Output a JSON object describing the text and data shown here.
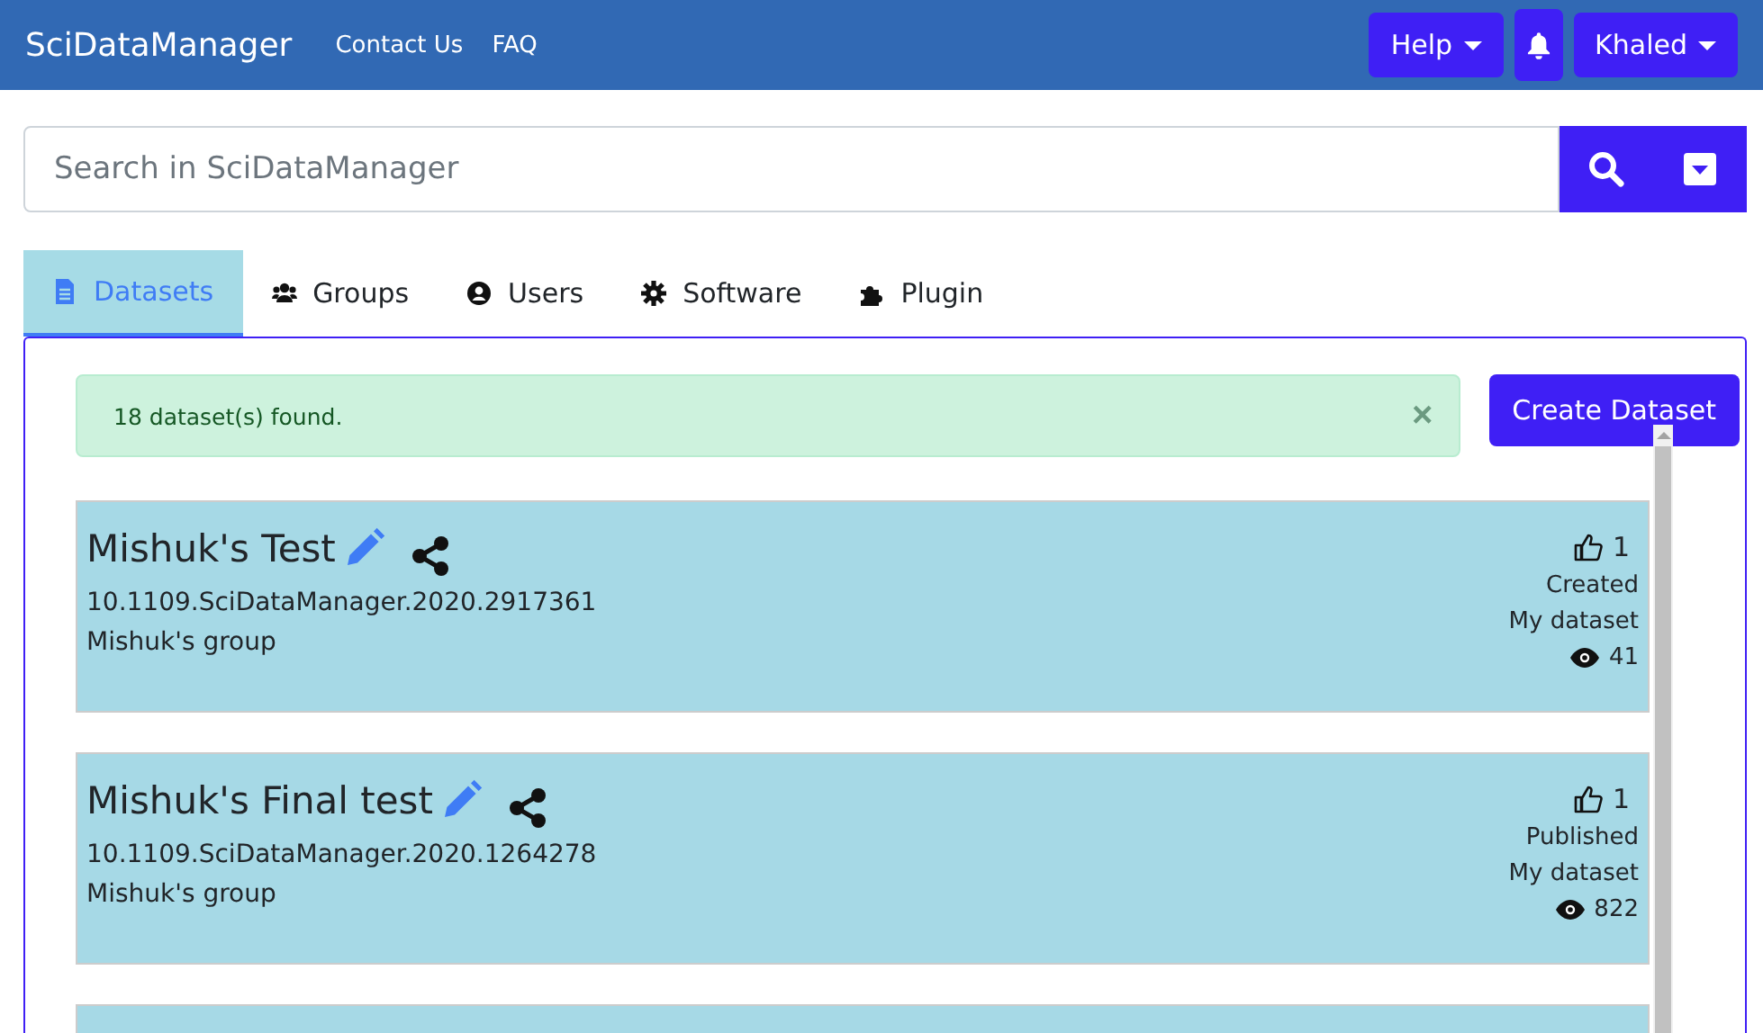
{
  "navbar": {
    "brand": "SciDataManager",
    "links": [
      "Contact Us",
      "FAQ"
    ],
    "help_label": "Help",
    "user_label": "Khaled"
  },
  "search": {
    "placeholder": "Search in SciDataManager"
  },
  "tabs": [
    {
      "label": "Datasets",
      "kind": "file",
      "selected": true
    },
    {
      "label": "Groups",
      "kind": "users",
      "selected": false
    },
    {
      "label": "Users",
      "kind": "user",
      "selected": false
    },
    {
      "label": "Software",
      "kind": "gear",
      "selected": false
    },
    {
      "label": "Plugin",
      "kind": "puzzle",
      "selected": false
    }
  ],
  "alert": {
    "text": "18 dataset(s) found.",
    "close": "×"
  },
  "create_button": "Create Dataset",
  "datasets": [
    {
      "title": "Mishuk's Test",
      "doi": "10.1109.SciDataManager.2020.2917361",
      "group": "Mishuk's group",
      "likes": "1",
      "status": "Created",
      "ownership": "My dataset",
      "views": "41"
    },
    {
      "title": "Mishuk's Final test",
      "doi": "10.1109.SciDataManager.2020.1264278",
      "group": "Mishuk's group",
      "likes": "1",
      "status": "Published",
      "ownership": "My dataset",
      "views": "822"
    }
  ]
}
